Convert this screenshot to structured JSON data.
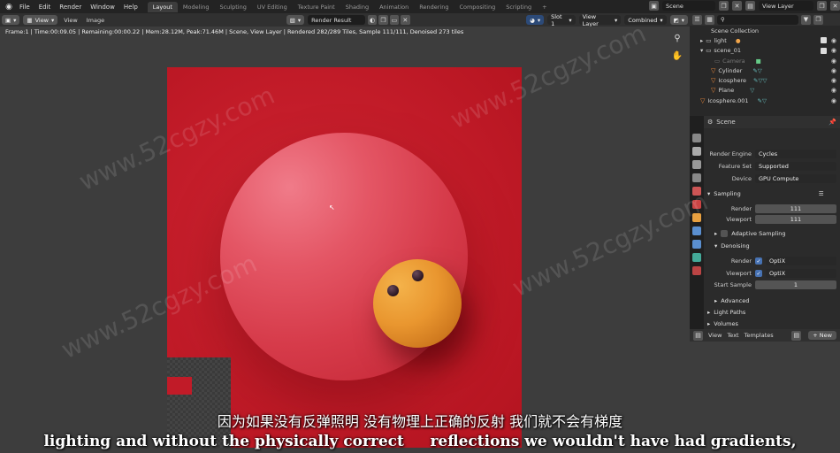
{
  "topbar": {
    "menu": [
      "File",
      "Edit",
      "Render",
      "Window",
      "Help"
    ],
    "workspaces": [
      "Layout",
      "Modeling",
      "Sculpting",
      "UV Editing",
      "Texture Paint",
      "Shading",
      "Animation",
      "Rendering",
      "Compositing",
      "Scripting",
      "+"
    ],
    "active_workspace": "Layout",
    "scene": "Scene",
    "view_layer": "View Layer"
  },
  "image_editor": {
    "view_menu": "View",
    "menus": [
      "View",
      "Image"
    ],
    "image_name": "Render Result",
    "slot": "Slot 1",
    "layer": "View Layer",
    "pass": "Combined",
    "status": "Frame:1 | Time:00:09.05 | Remaining:00:00.22 | Mem:28.12M, Peak:71.46M | Scene, View Layer | Rendered 282/289 Tiles, Sample 111/111, Denoised 273 tiles"
  },
  "outliner": {
    "search_placeholder": "",
    "rows": [
      {
        "label": "Scene Collection"
      },
      {
        "label": "light"
      },
      {
        "label": "scene_01"
      },
      {
        "label": "Camera"
      },
      {
        "label": "Cylinder"
      },
      {
        "label": "Icosphere"
      },
      {
        "label": "Plane"
      },
      {
        "label": "Icosphere.001"
      }
    ]
  },
  "properties": {
    "context": "Scene",
    "render_engine_label": "Render Engine",
    "render_engine": "Cycles",
    "feature_set_label": "Feature Set",
    "feature_set": "Supported",
    "device_label": "Device",
    "device": "GPU Compute",
    "sampling_title": "Sampling",
    "render_label": "Render",
    "render_samples": "111",
    "viewport_label": "Viewport",
    "viewport_samples": "111",
    "adaptive_sampling": "Adaptive Sampling",
    "denoising_title": "Denoising",
    "denoise_render_label": "Render",
    "denoise_render": "OptiX",
    "denoise_viewport_label": "Viewport",
    "denoise_viewport": "OptiX",
    "start_sample_label": "Start Sample",
    "start_sample": "1",
    "advanced": "Advanced",
    "light_paths": "Light Paths",
    "volumes": "Volumes"
  },
  "text_editor": {
    "menus": [
      "View",
      "Text",
      "Templates"
    ],
    "new_label": "+ New"
  },
  "subtitles": {
    "chinese": "因为如果没有反弹照明 没有物理上正确的反射 我们就不会有梯度",
    "english": "lighting and without the physically correct     reflections we wouldn't have had gradients,"
  },
  "watermark": "www.52cgzy.com"
}
